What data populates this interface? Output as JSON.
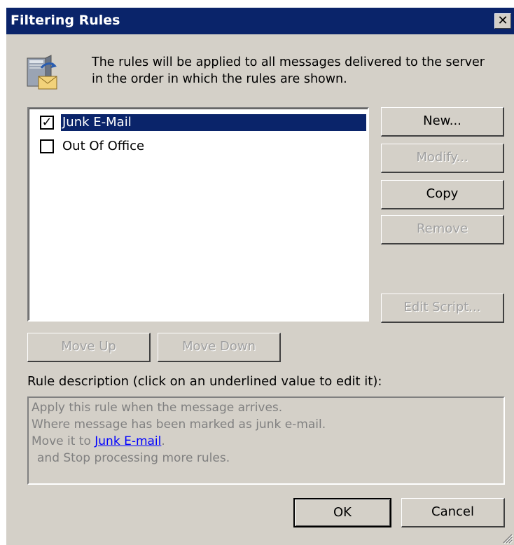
{
  "dialog": {
    "title": "Filtering Rules",
    "close_label": "✕",
    "info_text_line1": "The rules will be applied to all messages delivered to the server",
    "info_text_line2": "in the order in which the rules are shown."
  },
  "rules": [
    {
      "label": "Junk E-Mail",
      "checked": true,
      "selected": true
    },
    {
      "label": "Out Of Office",
      "checked": false,
      "selected": false
    }
  ],
  "buttons": {
    "new": "New...",
    "modify": "Modify...",
    "copy": "Copy",
    "remove": "Remove",
    "edit_script": "Edit Script...",
    "move_up": "Move Up",
    "move_down": "Move Down",
    "ok": "OK",
    "cancel": "Cancel"
  },
  "description": {
    "label": "Rule description (click on an underlined value to edit it):",
    "line1": "Apply this rule when the message arrives.",
    "line2": "Where message has been marked as junk e-mail.",
    "line3_prefix": "Move it to ",
    "line3_link": "Junk E-mail",
    "line3_suffix": ".",
    "line4": "and Stop processing more rules."
  },
  "colors": {
    "titlebar": "#0a246a",
    "dialog_bg": "#d4d0c8",
    "selection": "#0a246a",
    "link": "#0000ff"
  }
}
